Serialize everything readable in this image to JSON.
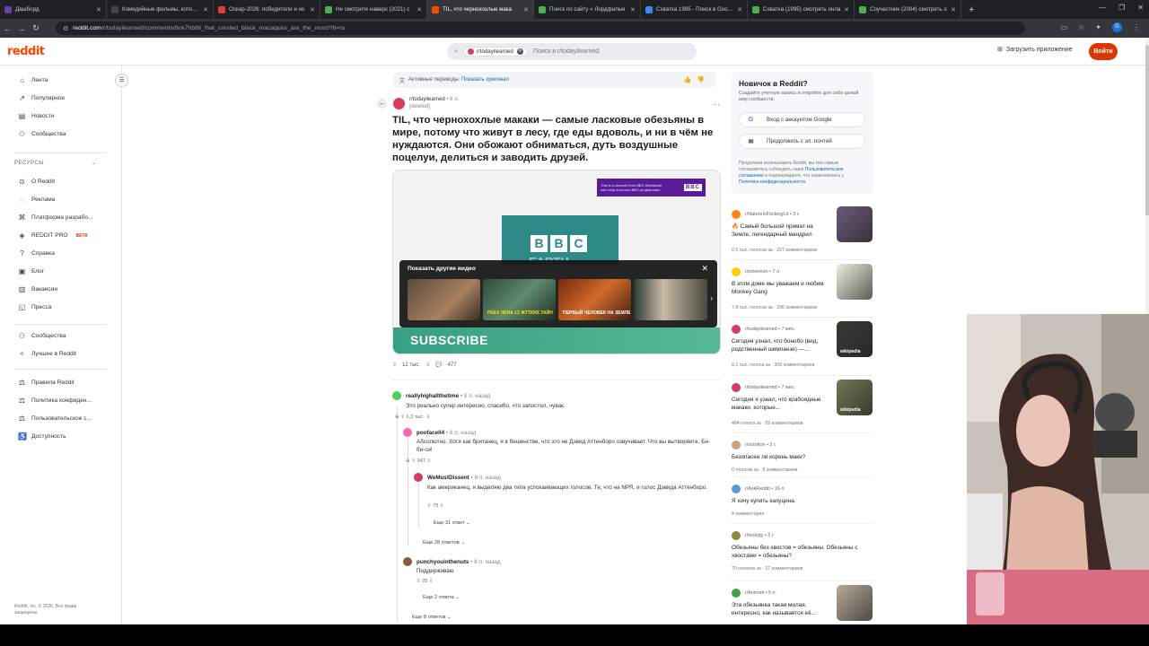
{
  "browser": {
    "tabs": [
      {
        "label": "Дашборд",
        "color": "#6441a5",
        "active": false
      },
      {
        "label": "Комедийные фильмы, которые",
        "color": "#444",
        "active": false
      },
      {
        "label": "Оскар-2026: победители и но",
        "color": "#e53935",
        "active": false
      },
      {
        "label": "Не смотрите наверх (2021) с",
        "color": "#4caf50",
        "active": false
      },
      {
        "label": "TIL, что чернохохлые мака",
        "color": "#ff4500",
        "active": true
      },
      {
        "label": "Поиск по сайту « Лордфильм",
        "color": "#4caf50",
        "active": false
      },
      {
        "label": "Схватка 1995 - Поиск в Google",
        "color": "#4285f4",
        "active": false
      },
      {
        "label": "Схватка (1995) смотреть онла",
        "color": "#4caf50",
        "active": false
      },
      {
        "label": "Соучастник (2004) смотреть о",
        "color": "#4caf50",
        "active": false
      }
    ],
    "new_tab": "+",
    "url_domain": "reddit.com",
    "url_rest": "/r/todayilearned/comments/8nk7hb/til_that_crested_black_macaques_are_the_most/?tl=ru",
    "profile_letter": "G"
  },
  "header": {
    "logo": "reddit",
    "search_chip": "r/todayilearned",
    "search_placeholder": "Поиск в r/todayilearned",
    "get_app": "Загрузить приложение",
    "login": "Войти"
  },
  "sidebar": {
    "main_items": [
      {
        "label": "Лента",
        "icon": "home-icon"
      },
      {
        "label": "Популярное",
        "icon": "popular-icon"
      },
      {
        "label": "Новости",
        "icon": "news-icon"
      },
      {
        "label": "Сообщества",
        "icon": "communities-icon"
      }
    ],
    "resources_heading": "РЕСУРСЫ",
    "resource_items": [
      {
        "label": "О Reddit"
      },
      {
        "label": "Реклама"
      },
      {
        "label": "Платформа разрабо..."
      },
      {
        "label": "REDDIT PRO",
        "badge": "BETA"
      },
      {
        "label": "Справка"
      },
      {
        "label": "Блог"
      },
      {
        "label": "Вакансии"
      },
      {
        "label": "Пресса"
      }
    ],
    "community_items": [
      {
        "label": "Сообщества"
      },
      {
        "label": "Лучшее в Reddit"
      }
    ],
    "policy_items": [
      {
        "label": "Правила Reddit"
      },
      {
        "label": "Политика конфиден..."
      },
      {
        "label": "Пользовательское с..."
      },
      {
        "label": "Доступность"
      }
    ],
    "copyright": "Reddit, Inc. © 2026. Все права защищены."
  },
  "post": {
    "translation_text": "Активные переводы",
    "translation_link": "Показать оригинал",
    "subreddit": "r/todayilearned",
    "time": "• 8 л.",
    "author": "[deleted]",
    "title": "TIL, что чернохохлые макаки — самые ласковые обезьяны в мире, потому что живут в лесу, где еды вдоволь, и ни в чём не нуждаются. Они обожают обниматься, дуть воздушные поцелуи, делиться и заводить друзей.",
    "video": {
      "promo_text": "This is a channel from BBC Worldwide who help fund new BBC programmes",
      "promo_logo": "BBC",
      "bbc_letters": [
        "B",
        "B",
        "C"
      ],
      "earth_text": "EARTH",
      "overlay_title": "Показать другие видео",
      "thumb_captions": [
        "",
        "РЕКА ЛЕНА 12 ЖУТКИХ ТАЙН",
        "ПЕРВЫЙ ЧЕЛОВЕК НА ЗЕМЛЕ",
        ""
      ],
      "subscribe": "SUBSCRIBE"
    },
    "votes": "12 тыс.",
    "comments": "477"
  },
  "comments": [
    {
      "user": "reallyhighallthetime",
      "time": "• 8 л. назад",
      "text": "Это реально супер интересно, спасибо, что запостил, чувак.",
      "votes": "1,3 тыс.",
      "color": "#46d160"
    },
    {
      "user": "poofacell4",
      "time": "• 8 л. назад",
      "text": "Абсолютно. Хотя как британец, я в бешенстве, что это не Дэвид Аттенборо озвучивает. Что вы вытворяете, Би-би-си!",
      "votes": "347",
      "color": "#ff66ac"
    },
    {
      "user": "WeMustDissent",
      "time": "• 8 л. назад",
      "text": "Как американец, я выделяю два типа успокаивающих голосов. Те, что на NPR, и голос Дэвида Аттенборо.",
      "votes": "75",
      "color": "#d93a5f"
    },
    {
      "more": "Еще 31 ответ"
    },
    {
      "more": "Еще 28 ответов"
    },
    {
      "user": "punchyouinthenuts",
      "time": "• 8 л. назад",
      "text": "Поддерживаю",
      "votes": "25",
      "color": "#8b5a3c"
    },
    {
      "more": "Еще 2 ответа"
    },
    {
      "more": "Еще 8 ответов"
    }
  ],
  "right": {
    "new_title": "Новичок в Reddit?",
    "new_desc": "Создайте учетную запись и откройте для себя целый мир сообществ.",
    "google_btn": "Вход с аккаунтом Google",
    "email_btn": "Продолжить с эл. почтой",
    "fine_pre": "Продолжая использовать Reddit, вы тем самым соглашаетесь соблюдать наше",
    "fine_link1": "Пользовательское соглашение",
    "fine_mid": "и подтверждаете, что ознакомились с",
    "fine_link2": "Политика конфиденциальности.",
    "items": [
      {
        "sub": "r/NatureIsFuckingLit",
        "time": "• 3 г.",
        "title": "🔥 Самый большой примат на Земле, легендарный мандрил",
        "stats": "6,6 тыс. голосов за  ·  207 комментариев",
        "color": "#ff8717",
        "thumb": "#6b5a7a"
      },
      {
        "sub": "r/pokemon",
        "time": "• 7 л.",
        "title": "В этом доме мы уважаем и любим Monkey Gang",
        "stats": "7,8 тыс. голосов за  ·  290 комментариев",
        "color": "#ffcc00",
        "thumb": "#e7f0dc"
      },
      {
        "sub": "r/todayilearned",
        "time": "• 7 мес.",
        "title": "Сегодня узнал, что бонобо (вид, родственный шимпанзе) —...",
        "stats": "9,1 тыс. голоса за  ·  305 комментариев",
        "color": "#d93a5f",
        "thumb": "#3a3a34",
        "wiki": "wikipedia"
      },
      {
        "sub": "r/todayilearned",
        "time": "• 7 мес.",
        "title": "Сегодня я узнал, что крабоядные макаки, которые...",
        "stats": "484 голоса за  ·  59 комментариев",
        "color": "#d93a5f",
        "thumb": "#6d7a52",
        "wiki": "wikipedia"
      },
      {
        "sub": "r/nutrition",
        "time": "• 2 г.",
        "title": "Безопасен ли корень маки?",
        "stats": "0 голосов за  ·  8 комментариев",
        "color": "#c9a27a"
      },
      {
        "sub": "r/AskReddit",
        "time": "• 16 л.",
        "title": "Я хочу купить капуцина.",
        "stats": "4 комментария",
        "color": "#5a9bd5"
      },
      {
        "sub": "r/biology",
        "time": "• 2 г.",
        "title": "Обезьяны без хвостов = обезьяны. Обезьяны с хвостами = обезьяны?",
        "stats": "70 голосов за  ·  37 комментариев",
        "color": "#8a8a3a"
      },
      {
        "sub": "r/Animali",
        "time": "• 5 л.",
        "title": "Эта обезьянка такая милая, интересно, как называется её...",
        "stats": "",
        "color": "#46a040",
        "thumb": "#b8aa98"
      }
    ]
  },
  "colors": {
    "brand": "#ff4500",
    "login": "#d93900",
    "link": "#0a66c2"
  }
}
